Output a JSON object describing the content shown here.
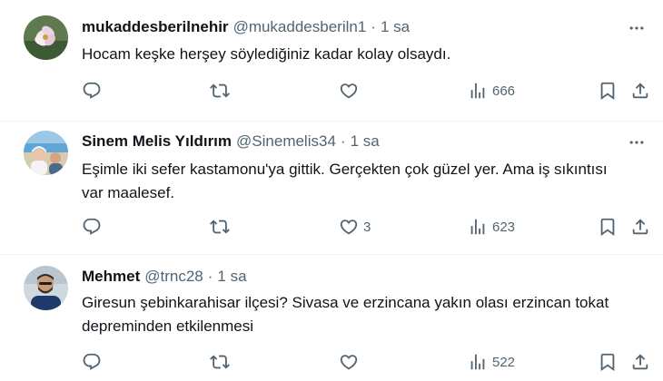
{
  "tweets": [
    {
      "name": "mukaddesberilnehir",
      "handle": "@mukaddesberiln1",
      "separator": "·",
      "time": "1 sa",
      "text": "Hocam keşke herşey söylediğiniz kadar kolay olsaydı.",
      "replies": "",
      "retweets": "",
      "likes": "",
      "views": "666"
    },
    {
      "name": "Sinem Melis Yıldırım",
      "handle": "@Sinemelis34",
      "separator": "·",
      "time": "1 sa",
      "text": "Eşimle iki sefer kastamonu'ya gittik. Gerçekten çok güzel yer. Ama iş sıkıntısı var maalesef.",
      "replies": "",
      "retweets": "",
      "likes": "3",
      "views": "623"
    },
    {
      "name": "Mehmet",
      "handle": "@trnc28",
      "separator": "·",
      "time": "1 sa",
      "text": "Giresun şebinkarahisar ilçesi? Sivasa ve erzincana yakın olası erzincan tokat depreminden etkilenmesi",
      "replies": "",
      "retweets": "",
      "likes": "",
      "views": "522"
    }
  ],
  "icons": {
    "reply": "reply-icon",
    "retweet": "retweet-icon",
    "like": "heart-icon",
    "views": "views-icon",
    "bookmark": "bookmark-icon",
    "share": "share-icon",
    "more": "more-icon"
  },
  "colors": {
    "text": "#0f1419",
    "secondary": "#536471",
    "divider": "#eff3f4"
  }
}
